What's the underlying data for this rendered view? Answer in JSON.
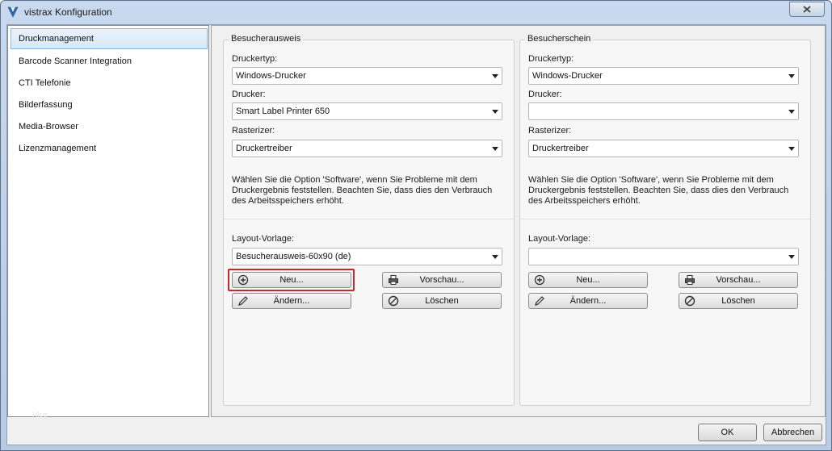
{
  "window": {
    "title": "vistrax Konfiguration"
  },
  "sidebar": {
    "items": [
      {
        "label": "Druckmanagement",
        "selected": true
      },
      {
        "label": "Barcode Scanner Integration",
        "selected": false
      },
      {
        "label": "CTI Telefonie",
        "selected": false
      },
      {
        "label": "Bilderfassung",
        "selected": false
      },
      {
        "label": "Media-Browser",
        "selected": false
      },
      {
        "label": "Lizenzmanagement",
        "selected": false
      }
    ],
    "watermark": "Hlog"
  },
  "groups": {
    "left": {
      "title": "Besucherausweis",
      "druckertyp_label": "Druckertyp:",
      "druckertyp_value": "Windows-Drucker",
      "drucker_label": "Drucker:",
      "drucker_value": "Smart Label Printer 650",
      "rasterizer_label": "Rasterizer:",
      "rasterizer_value": "Druckertreiber",
      "hint": "Wählen Sie die Option 'Software', wenn Sie Probleme mit dem Druckergebnis feststellen. Beachten Sie, dass dies den Verbrauch des Arbeitsspeichers erhöht.",
      "layout_label": "Layout-Vorlage:",
      "layout_value": "Besucherausweis-60x90 (de)",
      "buttons": {
        "neu": "Neu...",
        "vorschau": "Vorschau...",
        "aendern": "Ändern...",
        "loeschen": "Löschen"
      }
    },
    "right": {
      "title": "Besucherschein",
      "druckertyp_label": "Druckertyp:",
      "druckertyp_value": "Windows-Drucker",
      "drucker_label": "Drucker:",
      "drucker_value": "",
      "rasterizer_label": "Rasterizer:",
      "rasterizer_value": "Druckertreiber",
      "hint": "Wählen Sie die Option 'Software', wenn Sie Probleme mit dem Druckergebnis feststellen. Beachten Sie, dass dies den Verbrauch des Arbeitsspeichers erhöht.",
      "layout_label": "Layout-Vorlage:",
      "layout_value": "",
      "buttons": {
        "neu": "Neu...",
        "vorschau": "Vorschau...",
        "aendern": "Ändern...",
        "loeschen": "Löschen"
      }
    }
  },
  "footer": {
    "ok": "OK",
    "cancel": "Abbrechen"
  },
  "icons": {
    "app": "vistrax-logo-icon",
    "close": "close-icon",
    "neu": "add-circle-icon",
    "vorschau": "printer-icon",
    "aendern": "pencil-icon",
    "loeschen": "no-entry-icon",
    "dropdown": "chevron-down-icon"
  },
  "colors": {
    "highlight": "#c8282d",
    "selection": "#d8e8f8",
    "titlebar": "#c9d9ee"
  }
}
